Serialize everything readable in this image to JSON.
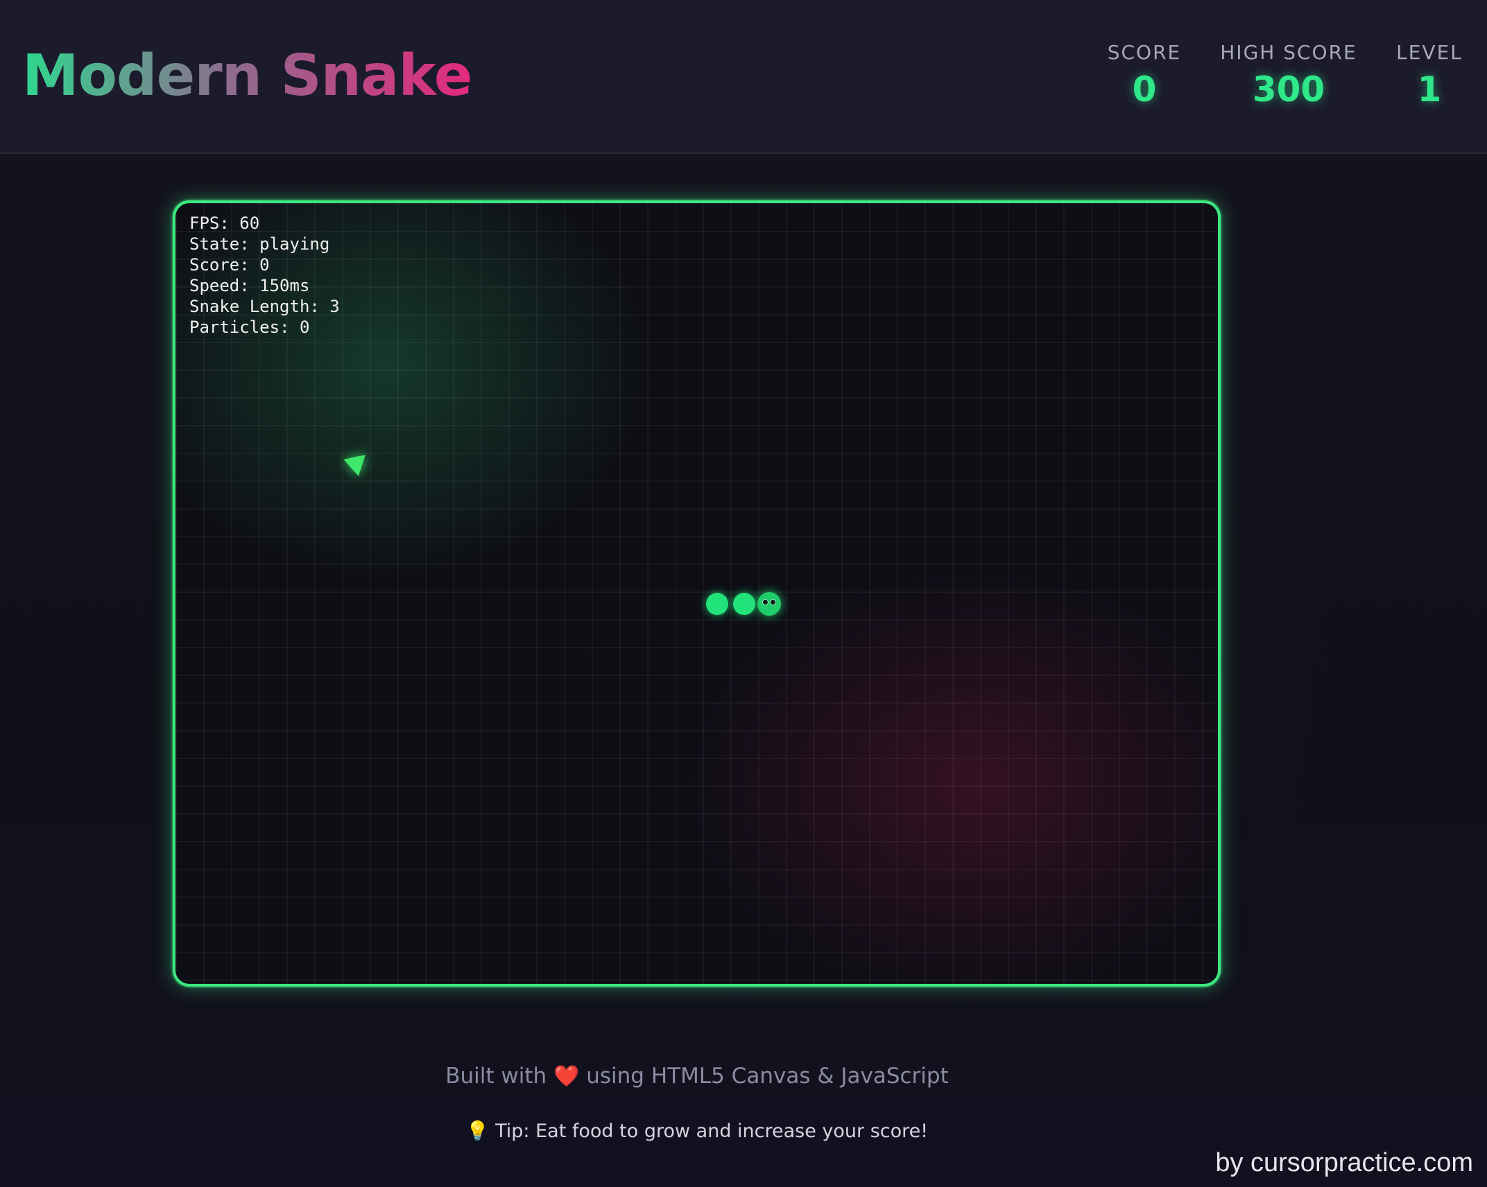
{
  "header": {
    "title": "Modern Snake",
    "stats": {
      "score_label": "SCORE",
      "score_value": "0",
      "high_score_label": "HIGH SCORE",
      "high_score_value": "300",
      "level_label": "LEVEL",
      "level_value": "1"
    }
  },
  "game": {
    "debug": {
      "fps": "FPS: 60",
      "state": "State: playing",
      "score": "Score: 0",
      "speed": "Speed: 150ms",
      "snake_length": "Snake Length: 3",
      "particles": "Particles: 0"
    },
    "snake_length": 3,
    "colors": {
      "border": "#3ee881",
      "snake": "#22e27a",
      "food": "#3ee86a"
    }
  },
  "footer": {
    "credit_before": "Built with",
    "heart_icon": "❤️",
    "credit_after": "using HTML5 Canvas & JavaScript",
    "tip_icon": "💡",
    "tip_text": "Tip: Eat food to grow and increase your score!"
  },
  "watermark": "by cursorpractice.com",
  "theme": {
    "accent_green": "#2ee88a",
    "accent_pink": "#e3297e",
    "background": "#111019",
    "header_background": "#1c1b2c"
  }
}
